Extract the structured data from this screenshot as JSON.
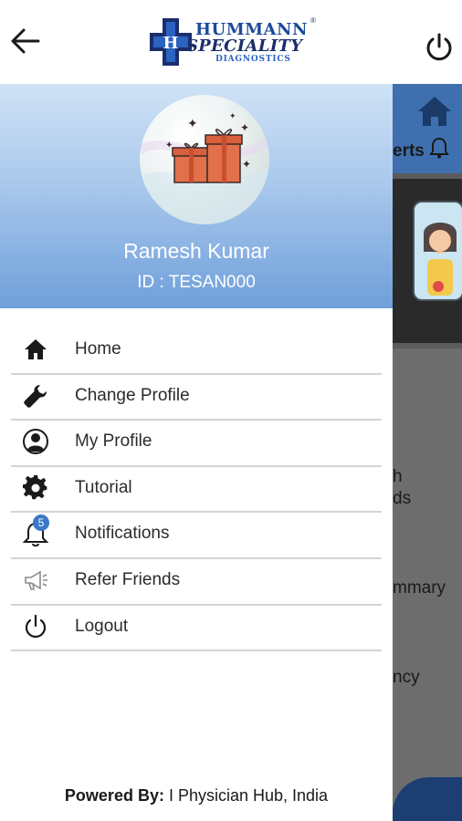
{
  "header": {
    "logo_line1": "HUMMANN",
    "logo_line2": "SPECIALITY",
    "logo_line3": "DIAGNOSTICS",
    "logo_reg": "®"
  },
  "background": {
    "alerts_text": "erts",
    "line1": "h",
    "line2": "ds",
    "line3": "mmary",
    "line4": "ncy"
  },
  "drawer": {
    "user_name": "Ramesh Kumar",
    "user_id": "ID : TESAN000",
    "menu": [
      {
        "label": "Home",
        "icon": "home-icon"
      },
      {
        "label": "Change Profile",
        "icon": "wrench-icon"
      },
      {
        "label": "My Profile",
        "icon": "user-circle-icon"
      },
      {
        "label": "Tutorial",
        "icon": "gear-icon"
      },
      {
        "label": "Notifications",
        "icon": "bell-icon",
        "badge": "5"
      },
      {
        "label": "Refer Friends",
        "icon": "megaphone-icon"
      },
      {
        "label": "Logout",
        "icon": "power-icon"
      }
    ],
    "footer_prefix": "Powered By:",
    "footer_text": " I Physician Hub, India"
  },
  "colors": {
    "brand_blue": "#1d4a9c",
    "header_gradient_top": "#cfe2f6",
    "header_gradient_bottom": "#6f9fda",
    "badge": "#3a78c9"
  }
}
